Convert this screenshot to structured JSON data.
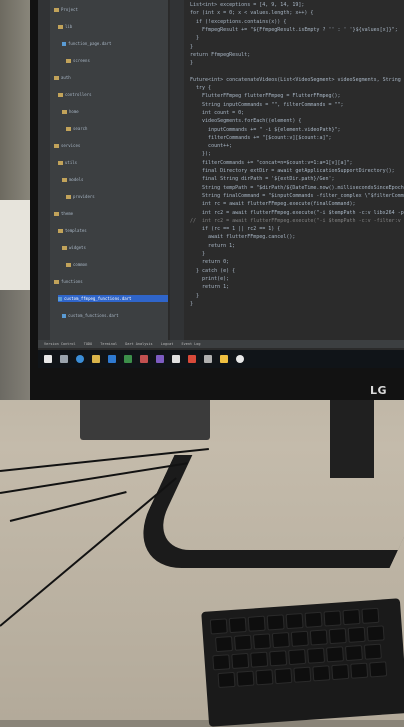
{
  "tree": {
    "rows": [
      {
        "label": "Project",
        "kind": "fold"
      },
      {
        "label": "lib",
        "kind": "folder"
      },
      {
        "label": "function_page.dart",
        "kind": "file"
      },
      {
        "label": "screens",
        "kind": "folder"
      },
      {
        "label": "auth",
        "kind": "folder"
      },
      {
        "label": "controllers",
        "kind": "folder"
      },
      {
        "label": "home",
        "kind": "folder"
      },
      {
        "label": "search",
        "kind": "folder"
      },
      {
        "label": "services",
        "kind": "folder"
      },
      {
        "label": "utils",
        "kind": "folder"
      },
      {
        "label": "models",
        "kind": "folder"
      },
      {
        "label": "providers",
        "kind": "folder"
      },
      {
        "label": "theme",
        "kind": "folder"
      },
      {
        "label": "templates",
        "kind": "folder"
      },
      {
        "label": "widgets",
        "kind": "folder"
      },
      {
        "label": "common",
        "kind": "folder"
      },
      {
        "label": "functions",
        "kind": "folder"
      },
      {
        "label": "custom_ffmpeg_functions.dart",
        "kind": "selected"
      },
      {
        "label": "custom_functions.dart",
        "kind": "file"
      }
    ]
  },
  "code": {
    "lines": [
      "List<int> exceptions = [4, 9, 14, 19];",
      "for (int x = 0; x < values.length; x++) {",
      "  if (!exceptions.contains(x)) {",
      "    FfmpegResult += \"${FfmpegResult.isEmpty ? '' : ' '}${values[x]}\";",
      "  }",
      "}",
      "return FfmpegResult;",
      "}",
      "",
      "Future<int> concatenateVideos(List<VideoSegment> videoSegments, String",
      "  try {",
      "    FlutterFFmpeg flutterFFmpeg = FlutterFFmpeg();",
      "    String inputCommands = \"\", filterCommands = \"\";",
      "    int count = 0;",
      "    videoSegments.forEach((element) {",
      "      inputCommands += \" -i ${element.videoPath}\";",
      "      filterCommands += \"[$count:v][$count:a]\";",
      "      count++;",
      "    });",
      "    filterCommands += \"concat=n=$count:v=1:a=1[v][a]\";",
      "    final Directory extDir = await getApplicationSupportDirectory();",
      "    final String dirPath = '${extDir.path}/Gen';",
      "    String tempPath = \"$dirPath/${DateTime.now().millisecondsSinceEpoch}",
      "    String finalCommand = \"$inputCommands -filter_complex \\\"$filterComman",
      "    int rc = await flutterFFmpeg.execute(finalCommand);",
      "    int rc2 = await flutterFFmpeg.execute(\"-i $tempPath -c:v libx264 -pre",
      "//  int rc2 = await flutterFFmpeg.execute(\"-i $tempPath -c:v -filter:v",
      "    if (rc == 1 || rc2 == 1) {",
      "      await flutterFFmpeg.cancel();",
      "      return 1;",
      "    }",
      "    return 0;",
      "  } catch (e) {",
      "    print(e);",
      "    return 1;",
      "  }",
      "}"
    ]
  },
  "statusbar": {
    "items": [
      "Version Control",
      "TODO",
      "Terminal",
      "Dart Analysis",
      "Logcat",
      "Event Log"
    ]
  },
  "monitor": {
    "brand": "LG"
  },
  "colors": {
    "editor_bg": "#2b2b2b",
    "sidebar_bg": "#3c3f41",
    "keyword": "#cc7832",
    "string": "#6a8759",
    "selection": "#2f65ca"
  }
}
